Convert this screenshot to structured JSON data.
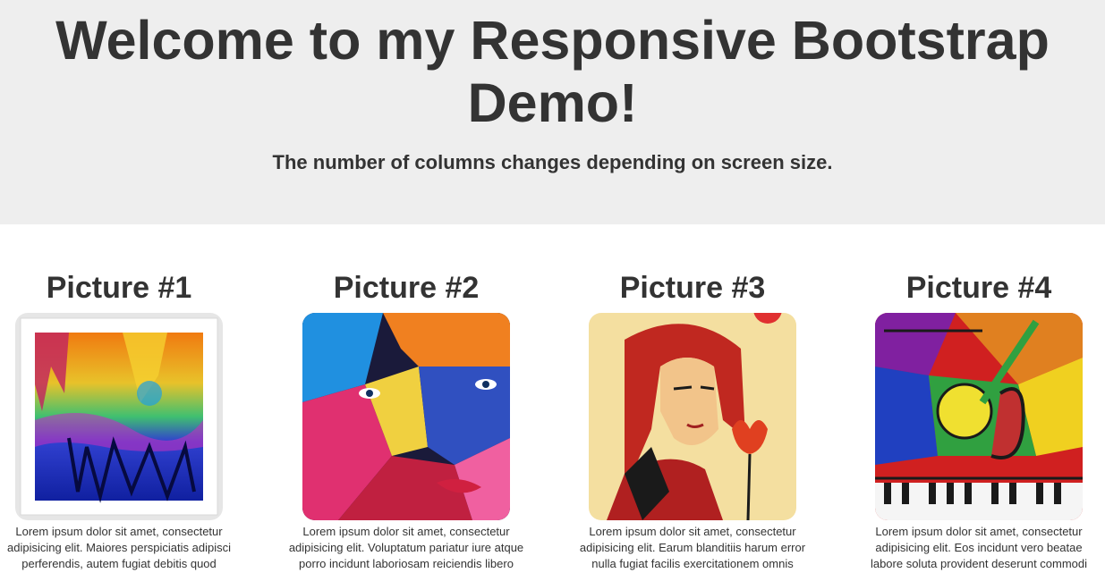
{
  "header": {
    "title": "Welcome to my Responsive Bootstrap Demo!",
    "subtitle": "The number of columns changes depending on screen size."
  },
  "cards": [
    {
      "title": "Picture #1",
      "text": [
        "Lorem ipsum dolor sit amet, consectetur",
        "adipisicing elit. Maiores perspiciatis adipisci",
        "perferendis, autem fugiat debitis quod"
      ],
      "image": "abstract-colorful-painting"
    },
    {
      "title": "Picture #2",
      "text": [
        "Lorem ipsum dolor sit amet, consectetur",
        "adipisicing elit. Voluptatum pariatur iure atque",
        "porro incidunt laboriosam reiciendis libero"
      ],
      "image": "colorful-faces-painting"
    },
    {
      "title": "Picture #3",
      "text": [
        "Lorem ipsum dolor sit amet, consectetur",
        "adipisicing elit. Earum blanditiis harum error",
        "nulla fugiat facilis exercitationem omnis"
      ],
      "image": "woman-with-lotus-poster"
    },
    {
      "title": "Picture #4",
      "text": [
        "Lorem ipsum dolor sit amet, consectetur",
        "adipisicing elit. Eos incidunt vero beatae",
        "labore soluta provident deserunt commodi"
      ],
      "image": "cubist-music-painting"
    }
  ]
}
